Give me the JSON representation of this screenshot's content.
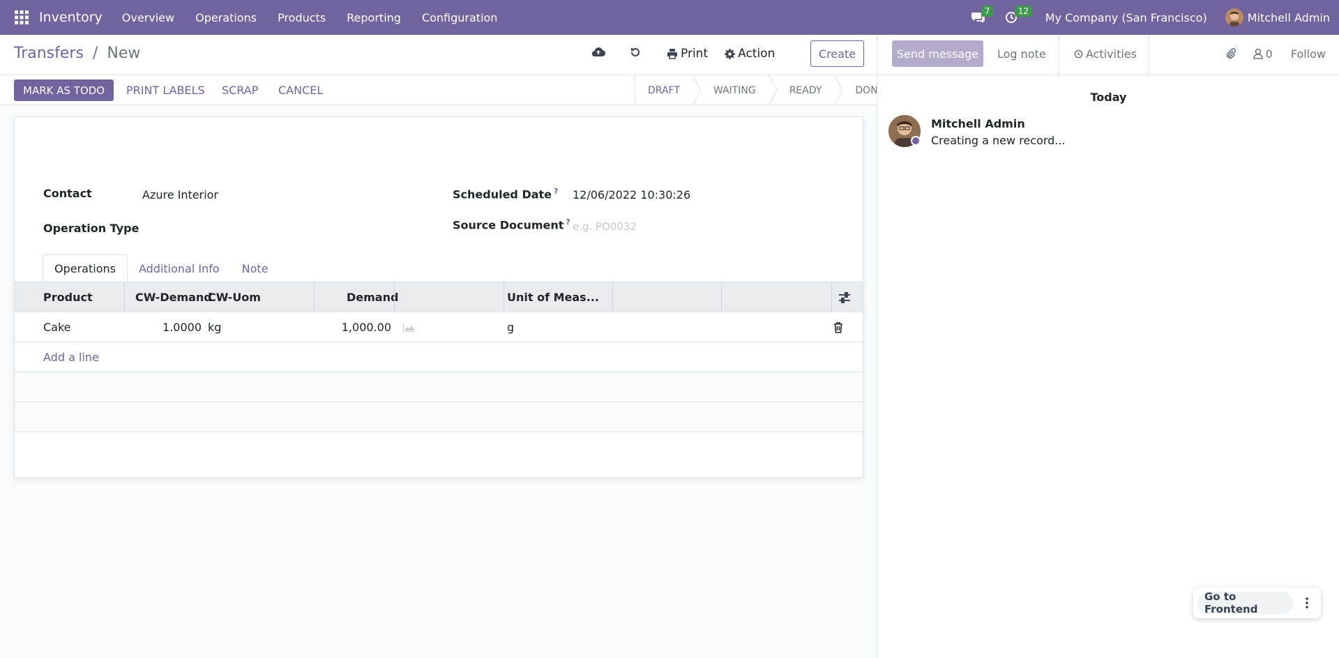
{
  "navbar": {
    "app_name": "Inventory",
    "menu": [
      "Overview",
      "Operations",
      "Products",
      "Reporting",
      "Configuration"
    ],
    "messages_count": "7",
    "activities_count": "12",
    "company": "My Company (San Francisco)",
    "user": "Mitchell Admin"
  },
  "control_panel": {
    "breadcrumb_parent": "Transfers",
    "breadcrumb_separator": "/",
    "breadcrumb_current": "New",
    "print_label": "Print",
    "action_label": "Action",
    "create_label": "Create"
  },
  "statusbar": {
    "buttons": {
      "mark_todo": "MARK AS TODO",
      "print_labels": "PRINT LABELS",
      "scrap": "SCRAP",
      "cancel": "CANCEL"
    },
    "steps": [
      "DRAFT",
      "WAITING",
      "READY",
      "DONE"
    ],
    "active_step": "DRAFT"
  },
  "form": {
    "contact_label": "Contact",
    "contact_value": "Azure Interior",
    "operation_type_label": "Operation Type",
    "scheduled_date_label": "Scheduled Date",
    "scheduled_date_value": "12/06/2022 10:30:26",
    "source_document_label": "Source Document",
    "source_document_placeholder": "e.g. PO0032",
    "help_mark": "?"
  },
  "tabs": [
    "Operations",
    "Additional Info",
    "Note"
  ],
  "table": {
    "headers": {
      "product": "Product",
      "cw_demand": "CW-Demand",
      "cw_uom": "CW-Uom",
      "demand": "Demand",
      "uom": "Unit of Meas..."
    },
    "rows": [
      {
        "product": "Cake",
        "cw_demand": "1.0000",
        "cw_uom": "kg",
        "demand": "1,000.00",
        "uom": "g"
      }
    ],
    "add_line": "Add a line"
  },
  "chatter": {
    "send_message": "Send message",
    "log_note": "Log note",
    "activities": "Activities",
    "followers_count": "0",
    "follow": "Follow",
    "date_separator": "Today",
    "message": {
      "author": "Mitchell Admin",
      "body": "Creating a new record..."
    }
  },
  "floating": {
    "go_to_frontend": "Go to Frontend"
  },
  "colors": {
    "primary": "#71639e",
    "badge_green": "#3e9a4b"
  }
}
